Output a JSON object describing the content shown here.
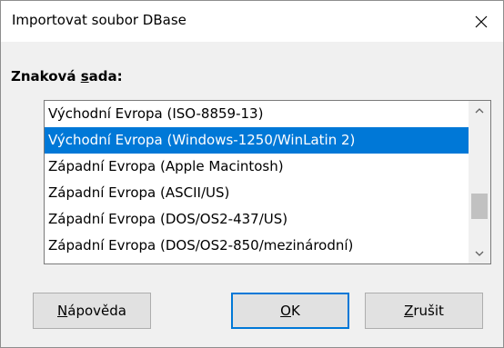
{
  "window": {
    "title": "Importovat soubor DBase",
    "close_icon": "close-icon"
  },
  "charset": {
    "label_before": "Znaková ",
    "label_accel": "s",
    "label_after": "ada:",
    "items": [
      "Východní Evropa (ISO-8859-13)",
      "Východní Evropa (Windows-1250/WinLatin 2)",
      "Západní Evropa (Apple Macintosh)",
      "Západní Evropa (ASCII/US)",
      "Západní Evropa (DOS/OS2-437/US)",
      "Západní Evropa (DOS/OS2-850/mezinárodní)"
    ],
    "selected_index": 1,
    "selection_color": "#0078d7"
  },
  "buttons": {
    "help_accel": "N",
    "help_rest": "ápověda",
    "ok_accel": "O",
    "ok_rest": "K",
    "cancel_accel": "Z",
    "cancel_rest": "rušit"
  }
}
